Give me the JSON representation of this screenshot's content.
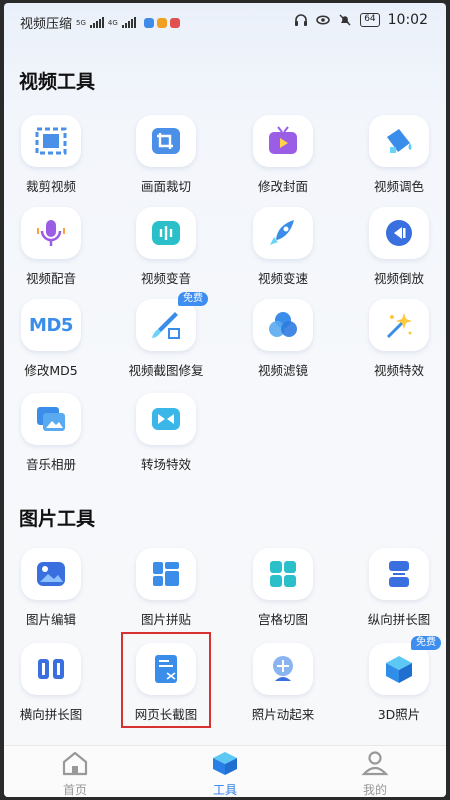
{
  "status_bar": {
    "app_title": "视频压缩",
    "hd": "HD",
    "network_5g": "5G",
    "network_4g": "4G",
    "battery": "64",
    "time": "10:02"
  },
  "sections": {
    "video": {
      "title": "视频工具",
      "items": [
        {
          "label": "裁剪视频",
          "icon": "crop-frame-icon"
        },
        {
          "label": "画面裁切",
          "icon": "crop-icon"
        },
        {
          "label": "修改封面",
          "icon": "tv-cover-icon"
        },
        {
          "label": "视频调色",
          "icon": "paint-bucket-icon"
        },
        {
          "label": "视频配音",
          "icon": "microphone-icon"
        },
        {
          "label": "视频变音",
          "icon": "voice-wave-icon"
        },
        {
          "label": "视频变速",
          "icon": "rocket-icon"
        },
        {
          "label": "视频倒放",
          "icon": "rewind-icon"
        },
        {
          "label": "修改MD5",
          "icon": "md5-icon"
        },
        {
          "label": "视频截图修复",
          "icon": "brush-icon",
          "badge": "免费"
        },
        {
          "label": "视频滤镜",
          "icon": "filter-circles-icon"
        },
        {
          "label": "视频特效",
          "icon": "sparkle-wand-icon"
        },
        {
          "label": "音乐相册",
          "icon": "photo-album-icon"
        },
        {
          "label": "转场特效",
          "icon": "transition-icon"
        }
      ]
    },
    "image": {
      "title": "图片工具",
      "items": [
        {
          "label": "图片编辑",
          "icon": "image-edit-icon"
        },
        {
          "label": "图片拼贴",
          "icon": "collage-icon"
        },
        {
          "label": "宫格切图",
          "icon": "grid-cut-icon"
        },
        {
          "label": "纵向拼长图",
          "icon": "vertical-stitch-icon"
        },
        {
          "label": "横向拼长图",
          "icon": "horizontal-stitch-icon"
        },
        {
          "label": "网页长截图",
          "icon": "web-screenshot-icon"
        },
        {
          "label": "照片动起来",
          "icon": "animate-photo-icon"
        },
        {
          "label": "3D照片",
          "icon": "cube-3d-icon",
          "badge": "免费"
        }
      ]
    }
  },
  "bottom_nav": {
    "items": [
      {
        "label": "首页",
        "icon": "home-icon"
      },
      {
        "label": "工具",
        "icon": "toolbox-icon",
        "active": true
      },
      {
        "label": "我的",
        "icon": "user-icon"
      }
    ]
  },
  "colors": {
    "accent": "#2a7fe6",
    "badge": "#3d8ef0",
    "highlight": "#d93030"
  }
}
